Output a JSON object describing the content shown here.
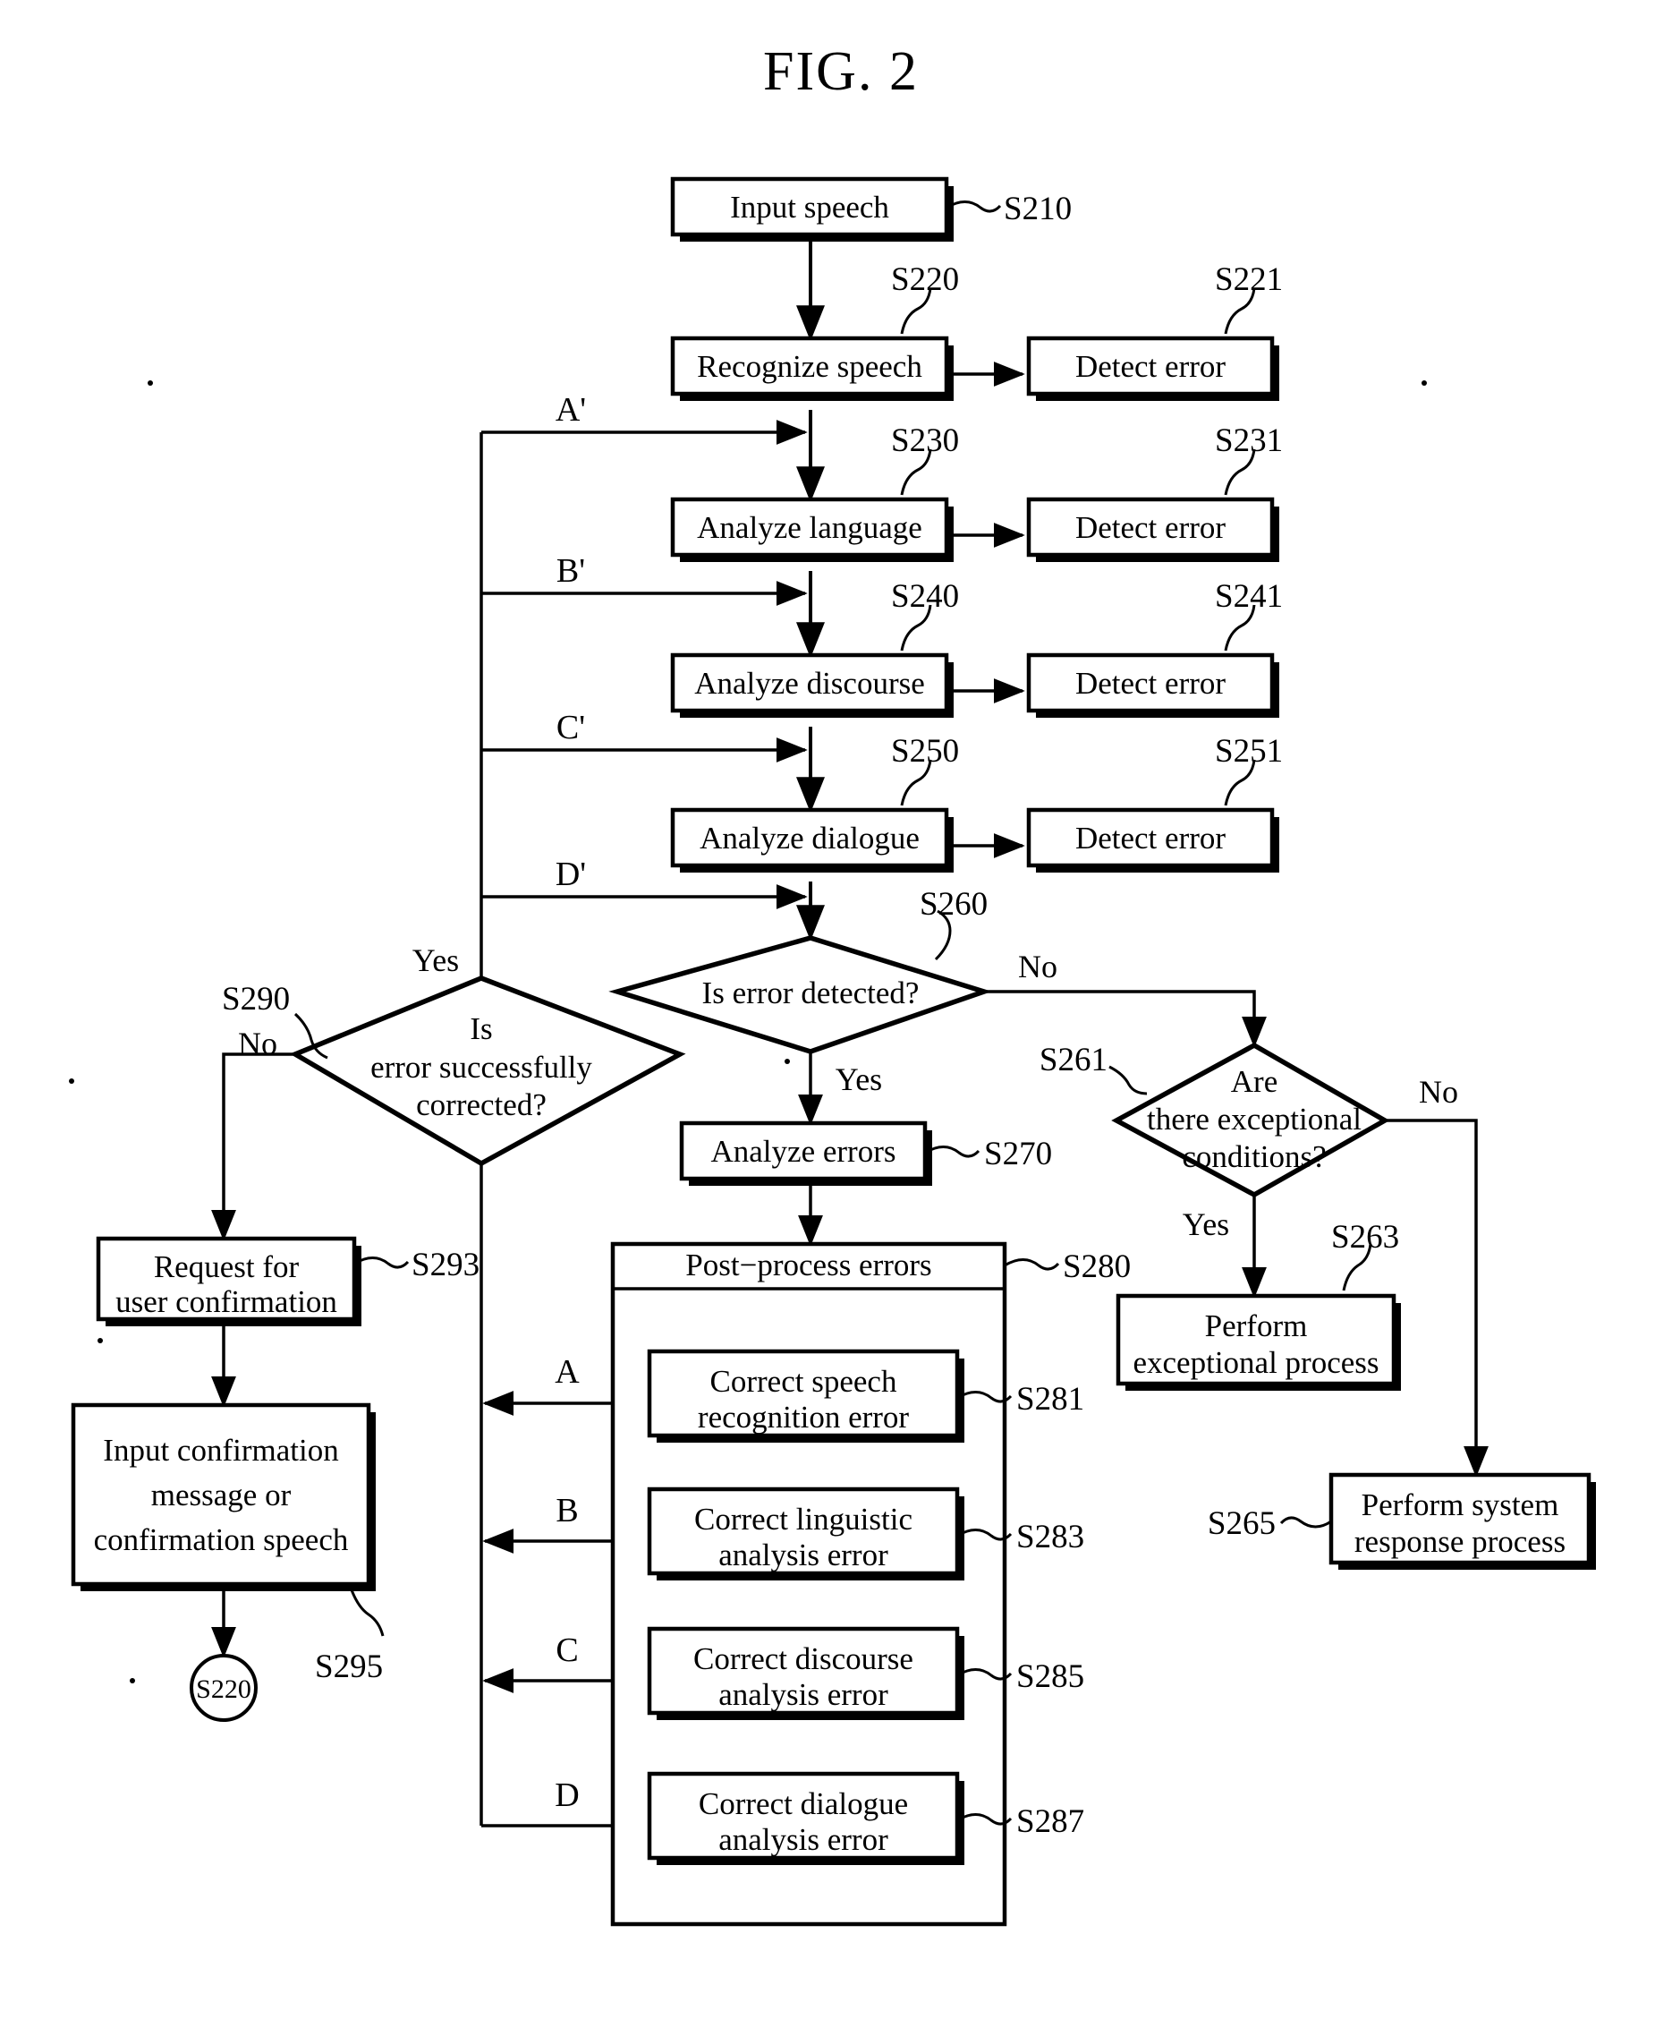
{
  "figure": {
    "title": "FIG. 2",
    "type": "patent-flowchart"
  },
  "nodes": {
    "input_speech": {
      "label": "Input speech",
      "step": "S210"
    },
    "recognize_speech": {
      "label": "Recognize speech",
      "step": "S220"
    },
    "detect_error_1": {
      "label": "Detect error",
      "step": "S221"
    },
    "analyze_language": {
      "label": "Analyze language",
      "step": "S230"
    },
    "detect_error_2": {
      "label": "Detect error",
      "step": "S231"
    },
    "analyze_discourse": {
      "label": "Analyze discourse",
      "step": "S240"
    },
    "detect_error_3": {
      "label": "Detect error",
      "step": "S241"
    },
    "analyze_dialogue": {
      "label": "Analyze dialogue",
      "step": "S250"
    },
    "detect_error_4": {
      "label": "Detect error",
      "step": "S251"
    },
    "is_error_detected": {
      "label": "Is error detected?",
      "step": "S260"
    },
    "are_exceptional_conditions": {
      "label_line1": "Are",
      "label_line2": "there exceptional",
      "label_line3": "conditions?",
      "step": "S261"
    },
    "perform_exceptional_process": {
      "label_line1": "Perform",
      "label_line2": "exceptional process",
      "step": "S263"
    },
    "perform_system_response": {
      "label_line1": "Perform system",
      "label_line2": "response process",
      "step": "S265"
    },
    "analyze_errors": {
      "label": "Analyze errors",
      "step": "S270"
    },
    "post_process_errors": {
      "label": "Post−process errors",
      "step": "S280"
    },
    "correct_speech_recognition_error": {
      "label_line1": "Correct speech",
      "label_line2": "recognition error",
      "step": "S281"
    },
    "correct_linguistic_analysis_error": {
      "label_line1": "Correct linguistic",
      "label_line2": "analysis error",
      "step": "S283"
    },
    "correct_discourse_analysis_error": {
      "label_line1": "Correct discourse",
      "label_line2": "analysis error",
      "step": "S285"
    },
    "correct_dialogue_analysis_error": {
      "label_line1": "Correct dialogue",
      "label_line2": "analysis error",
      "step": "S287"
    },
    "is_error_successfully_corrected": {
      "label_line1": "Is",
      "label_line2": "error successfully",
      "label_line3": "corrected?",
      "step": "S290"
    },
    "request_for_user_confirmation": {
      "label_line1": "Request for",
      "label_line2": "user confirmation",
      "step": "S293"
    },
    "input_confirmation": {
      "label_line1": "Input confirmation",
      "label_line2": "message or",
      "label_line3": "confirmation speech",
      "step": "S295"
    },
    "connector_s220": {
      "label": "S220"
    }
  },
  "edge_labels": {
    "error_detected_yes": "Yes",
    "error_detected_no": "No",
    "exceptional_yes": "Yes",
    "exceptional_no": "No",
    "corrected_yes": "Yes",
    "corrected_no": "No"
  },
  "ports": {
    "a_prime": "A'",
    "b_prime": "B'",
    "c_prime": "C'",
    "d_prime": "D'",
    "a": "A",
    "b": "B",
    "c": "C",
    "d": "D"
  },
  "colors": {
    "ink": "#000000",
    "paper": "#ffffff"
  }
}
